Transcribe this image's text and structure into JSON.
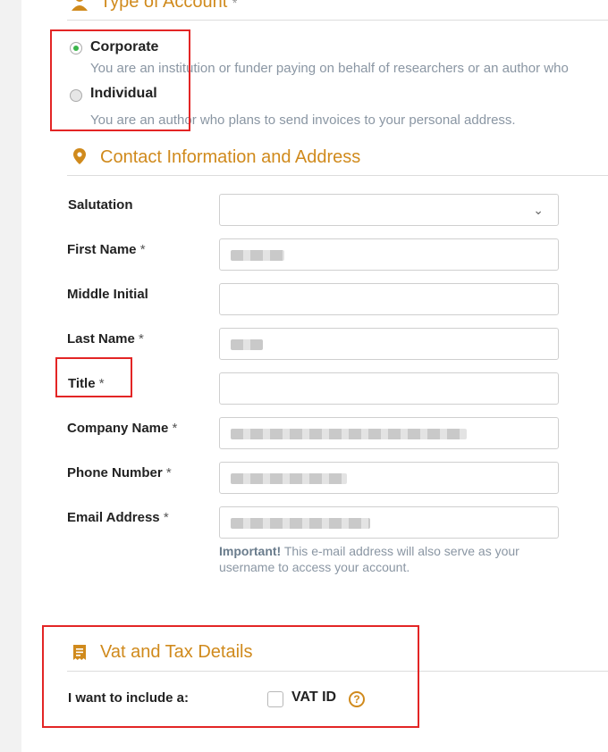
{
  "type_of_account": {
    "heading": "Type of Account",
    "required_mark": "*",
    "options": [
      {
        "label": "Corporate",
        "description": "You are an institution or funder paying on behalf of researchers or an author who",
        "checked": true
      },
      {
        "label": "Individual",
        "description": "You are an author who plans to send invoices to your personal address.",
        "checked": false
      }
    ]
  },
  "contact": {
    "heading": "Contact Information and Address",
    "icon": "map-pin-icon",
    "fields": {
      "salutation": {
        "label": "Salutation",
        "required": ""
      },
      "first_name": {
        "label": "First Name",
        "required": "*"
      },
      "middle_initial": {
        "label": "Middle Initial",
        "required": ""
      },
      "last_name": {
        "label": "Last Name",
        "required": "*"
      },
      "title": {
        "label": "Title",
        "required": "*"
      },
      "company_name": {
        "label": "Company Name",
        "required": "*"
      },
      "phone_number": {
        "label": "Phone Number",
        "required": "*"
      },
      "email_address": {
        "label": "Email Address",
        "required": "*"
      }
    },
    "email_note_strong": "Important!",
    "email_note": "This e-mail address will also serve as your username to access your account."
  },
  "vat": {
    "heading": "Vat and Tax Details",
    "icon": "receipt-icon",
    "include_label": "I want to include a:",
    "checkbox_label": "VAT ID",
    "help_glyph": "?"
  },
  "colors": {
    "accent": "#d08a1c",
    "radio_checked": "#3ab54a",
    "annotation": "#e32525"
  }
}
